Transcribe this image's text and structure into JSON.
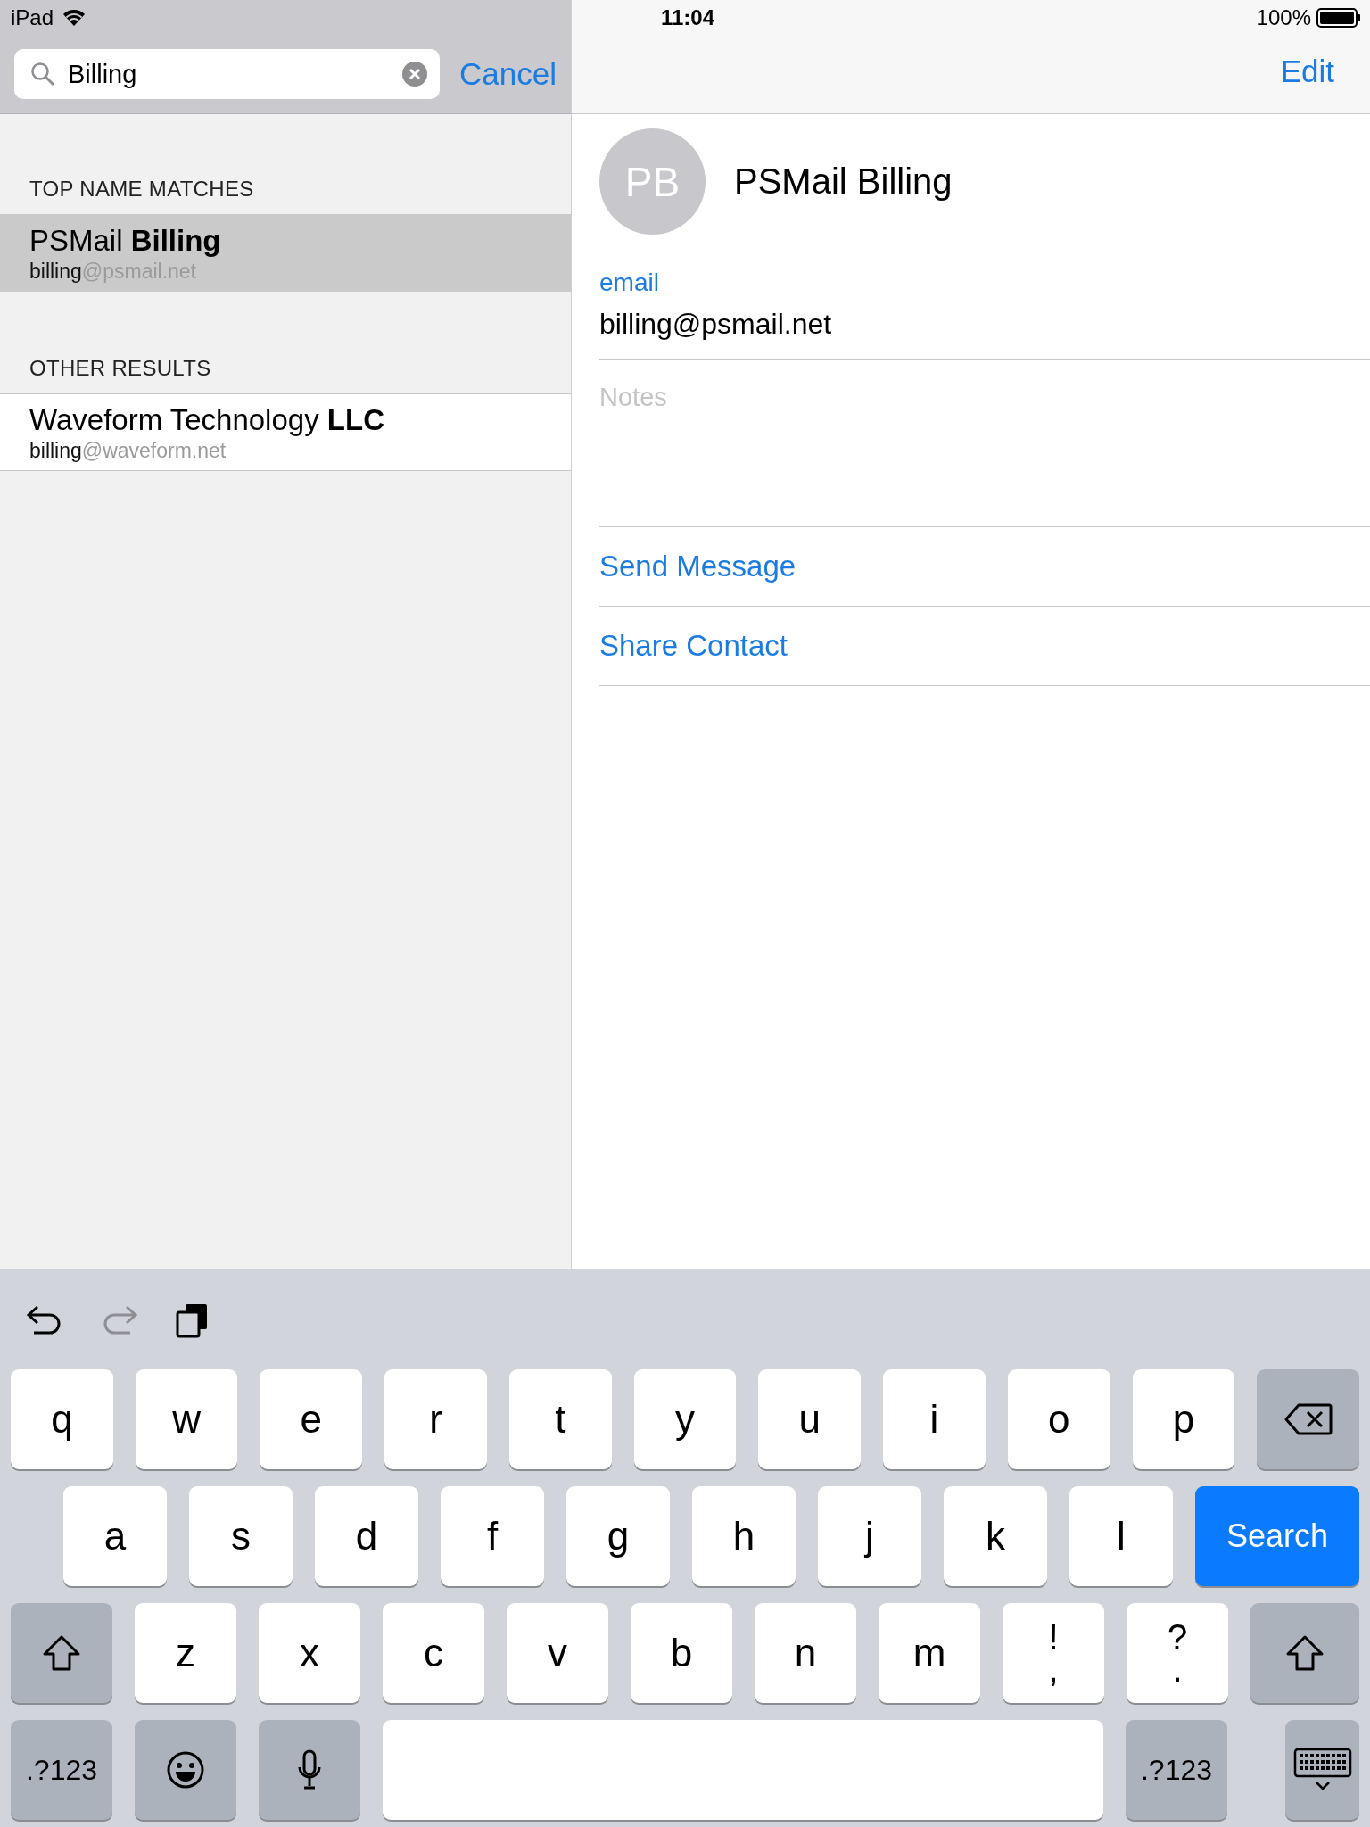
{
  "status_bar": {
    "device": "iPad",
    "time": "11:04",
    "battery": "100%"
  },
  "search": {
    "value": "Billing",
    "cancel": "Cancel"
  },
  "sections": [
    {
      "title": "TOP NAME MATCHES",
      "results": [
        {
          "name": "PSMail **Billing**",
          "email_match": "billing",
          "email_rest": "@psmail.net",
          "selected": true
        }
      ]
    },
    {
      "title": "OTHER RESULTS",
      "results": [
        {
          "name": "Waveform Technology **LLC**",
          "email_match": "billing",
          "email_rest": "@waveform.net",
          "selected": false
        }
      ]
    }
  ],
  "detail": {
    "edit": "Edit",
    "initials": "PB",
    "name": "PSMail Billing",
    "fields": [
      {
        "label": "email",
        "value": "billing@psmail.net"
      }
    ],
    "notes_placeholder": "Notes",
    "actions": [
      "Send Message",
      "Share Contact"
    ]
  },
  "keyboard": {
    "toolbar": [
      {
        "kind": "undo",
        "disabled": false
      },
      {
        "kind": "redo",
        "disabled": true
      },
      {
        "kind": "paste",
        "disabled": false
      }
    ],
    "rows": [
      {
        "keys": [
          {
            "kind": "char",
            "label": "q"
          },
          {
            "kind": "char",
            "label": "w"
          },
          {
            "kind": "char",
            "label": "e"
          },
          {
            "kind": "char",
            "label": "r"
          },
          {
            "kind": "char",
            "label": "t"
          },
          {
            "kind": "char",
            "label": "y"
          },
          {
            "kind": "char",
            "label": "u"
          },
          {
            "kind": "char",
            "label": "i"
          },
          {
            "kind": "char",
            "label": "o"
          },
          {
            "kind": "char",
            "label": "p"
          },
          {
            "kind": "backspace"
          }
        ]
      },
      {
        "keys": [
          {
            "kind": "char",
            "label": "a"
          },
          {
            "kind": "char",
            "label": "s"
          },
          {
            "kind": "char",
            "label": "d"
          },
          {
            "kind": "char",
            "label": "f"
          },
          {
            "kind": "char",
            "label": "g"
          },
          {
            "kind": "char",
            "label": "h"
          },
          {
            "kind": "char",
            "label": "j"
          },
          {
            "kind": "char",
            "label": "k"
          },
          {
            "kind": "char",
            "label": "l"
          },
          {
            "kind": "search",
            "label": "Search"
          }
        ]
      },
      {
        "keys": [
          {
            "kind": "shift"
          },
          {
            "kind": "char",
            "label": "z"
          },
          {
            "kind": "char",
            "label": "x"
          },
          {
            "kind": "char",
            "label": "c"
          },
          {
            "kind": "char",
            "label": "v"
          },
          {
            "kind": "char",
            "label": "b"
          },
          {
            "kind": "char",
            "label": "n"
          },
          {
            "kind": "char",
            "label": "m"
          },
          {
            "kind": "dual",
            "top": "!",
            "bottom": ","
          },
          {
            "kind": "dual",
            "top": "?",
            "bottom": "."
          },
          {
            "kind": "shift"
          }
        ]
      },
      {
        "keys": [
          {
            "kind": "mode",
            "label": ".?123"
          },
          {
            "kind": "emoji"
          },
          {
            "kind": "mic"
          },
          {
            "kind": "space"
          },
          {
            "kind": "mode",
            "label": ".?123"
          },
          {
            "kind": "dismiss"
          }
        ]
      }
    ]
  }
}
